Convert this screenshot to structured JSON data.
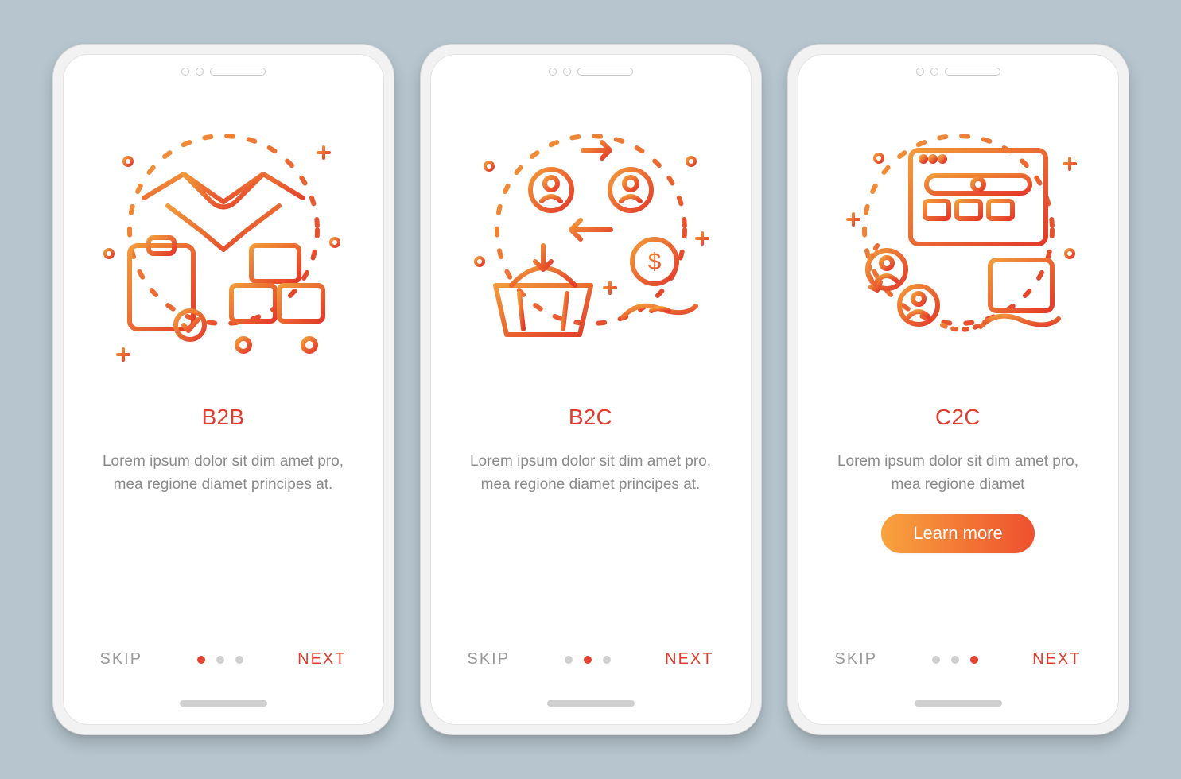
{
  "colors": {
    "accent": "#e13d2e",
    "gradientStart": "#f8a33e",
    "gradientEnd": "#ee502e",
    "muted": "#9a9a9a",
    "body": "#8a8a8a"
  },
  "screens": [
    {
      "title": "B2B",
      "description": "Lorem ipsum dolor sit dim amet pro, mea regione diamet principes at.",
      "icon": "b2b-handshake-icon",
      "skip": "SKIP",
      "next": "NEXT",
      "activeDot": 0,
      "cta": null
    },
    {
      "title": "B2C",
      "description": "Lorem ipsum dolor sit dim amet pro, mea regione diamet principes at.",
      "icon": "b2c-basket-icon",
      "skip": "SKIP",
      "next": "NEXT",
      "activeDot": 1,
      "cta": null
    },
    {
      "title": "C2C",
      "description": "Lorem ipsum dolor sit dim amet pro, mea regione diamet",
      "icon": "c2c-marketplace-icon",
      "skip": "SKIP",
      "next": "NEXT",
      "activeDot": 2,
      "cta": "Learn more"
    }
  ]
}
